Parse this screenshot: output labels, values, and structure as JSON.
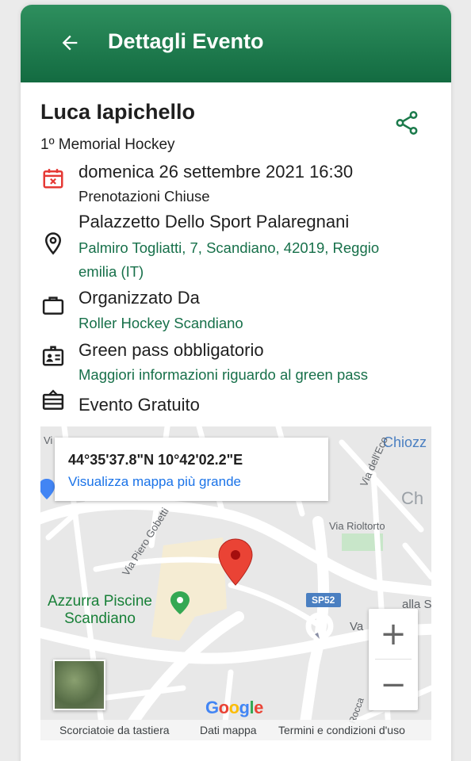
{
  "appbar": {
    "title": "Dettagli Evento"
  },
  "event": {
    "name": "Luca Iapichello",
    "subtitle": "1º Memorial Hockey",
    "date": "domenica 26 settembre 2021 16:30",
    "booking_status": "Prenotazioni Chiuse",
    "venue": "Palazzetto Dello Sport Palaregnani",
    "address_line1": "Palmiro Togliatti, 7, Scandiano, 42019, Reggio",
    "address_line2": "emilia (IT)",
    "organizer_label": "Organizzato Da",
    "organizer": "Roller Hockey Scandiano",
    "greenpass_label": "Green pass obbligatorio",
    "greenpass_link": "Maggiori informazioni riguardo al green pass",
    "price": "Evento Gratuito"
  },
  "map": {
    "coords": "44°35'37.8\"N 10°42'02.2\"E",
    "bigger_map": "Visualizza mappa più grande",
    "labels": {
      "chiozz": "Chiozz",
      "ch": "Ch",
      "vi": "Vi",
      "via_dell_eco": "Via dell'Eco",
      "via_riolto": "Via Rioltorto",
      "via_gobetti": "Via Piero Gobetti",
      "sp52": "SP52",
      "alla": "alla S",
      "va": "Va",
      "rocca": "Rocca",
      "poi_line1": "Azzurra Piscine",
      "poi_line2": "Scandiano"
    },
    "zoom_in": "+",
    "zoom_out": "−",
    "google": [
      "G",
      "o",
      "o",
      "g",
      "l",
      "e"
    ],
    "google_colors": [
      "#4285F4",
      "#EA4335",
      "#FBBC05",
      "#4285F4",
      "#34A853",
      "#EA4335"
    ],
    "footer": {
      "shortcuts": "Scorciatoie da tastiera",
      "map_data": "Dati mappa",
      "terms": "Termini e condizioni d'uso"
    }
  },
  "colors": {
    "primary": "#1b7a4b",
    "link": "#17704a",
    "calendar": "#e53935",
    "marker": "#ea4335"
  }
}
